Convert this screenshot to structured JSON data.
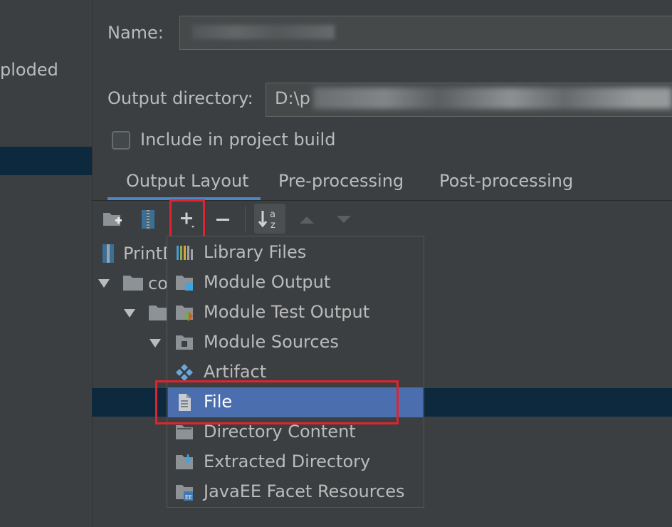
{
  "left_panel": {
    "partial_label": "ploded"
  },
  "form": {
    "name_label": "Name:",
    "output_directory_label": "Output directory:",
    "output_directory_value": "D:\\p",
    "include_in_build_label": "Include in project build",
    "include_in_build_checked": false
  },
  "tabs": [
    {
      "label": "Output Layout",
      "active": true
    },
    {
      "label": "Pre-processing",
      "active": false
    },
    {
      "label": "Post-processing",
      "active": false
    }
  ],
  "toolbar": {
    "icons": [
      "new-folder-icon",
      "archive-icon",
      "add-icon",
      "remove-icon",
      "sort-icon",
      "move-up-icon",
      "move-down-icon"
    ]
  },
  "tree": {
    "items": [
      {
        "label": "PrintD",
        "icon": "archive-icon"
      },
      {
        "label": "co",
        "icon": "folder-icon",
        "expanded": true
      }
    ]
  },
  "add_menu": {
    "items": [
      {
        "label": "Library Files",
        "icon": "library-icon"
      },
      {
        "label": "Module Output",
        "icon": "module-output-icon"
      },
      {
        "label": "Module Test Output",
        "icon": "module-test-output-icon"
      },
      {
        "label": "Module Sources",
        "icon": "module-sources-icon"
      },
      {
        "label": "Artifact",
        "icon": "artifact-icon"
      },
      {
        "label": "File",
        "icon": "file-icon",
        "selected": true
      },
      {
        "label": "Directory Content",
        "icon": "directory-content-icon"
      },
      {
        "label": "Extracted Directory",
        "icon": "extracted-directory-icon"
      },
      {
        "label": "JavaEE Facet Resources",
        "icon": "javaee-facet-icon"
      }
    ]
  },
  "colors": {
    "background": "#3c3f41",
    "selection_dark": "#0d293e",
    "menu_selection": "#4b6eaf",
    "highlight_red": "#e0232e",
    "tab_underline": "#4a88c7"
  }
}
